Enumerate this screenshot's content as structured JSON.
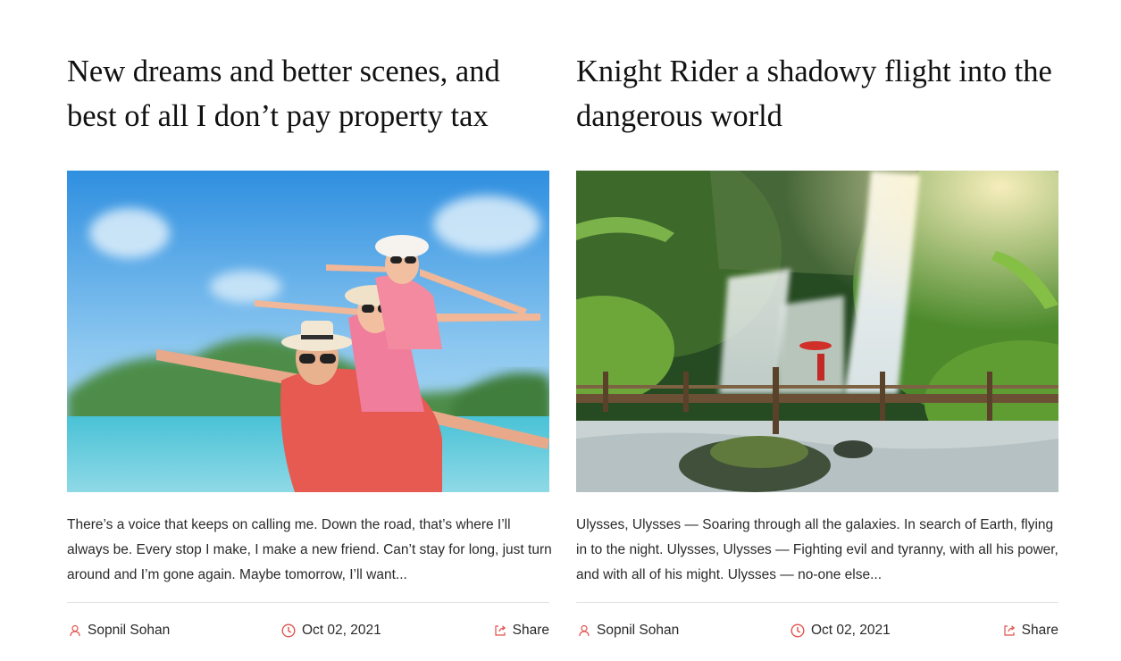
{
  "accent_color": "#e2524c",
  "posts": [
    {
      "title": "New dreams and better scenes, and best of all I don’t pay property tax",
      "image_subject": "family-beach-photo",
      "excerpt": "There’s a voice that keeps on calling me. Down the road, that’s where I’ll always be. Every stop I make, I make a new friend. Can’t stay for long, just turn around and I’m gone again. Maybe tomorrow, I’ll want...",
      "author": "Sopnil Sohan",
      "date": "Oct 02, 2021",
      "share_label": "Share"
    },
    {
      "title": "Knight Rider a shadowy flight into the dangerous world",
      "image_subject": "waterfall-bridge-photo",
      "excerpt": "Ulysses, Ulysses — Soaring through all the galaxies. In search of Earth, flying in to the night. Ulysses, Ulysses — Fighting evil and tyranny, with all his power, and with all of his might. Ulysses — no-one else...",
      "author": "Sopnil Sohan",
      "date": "Oct 02, 2021",
      "share_label": "Share"
    }
  ]
}
